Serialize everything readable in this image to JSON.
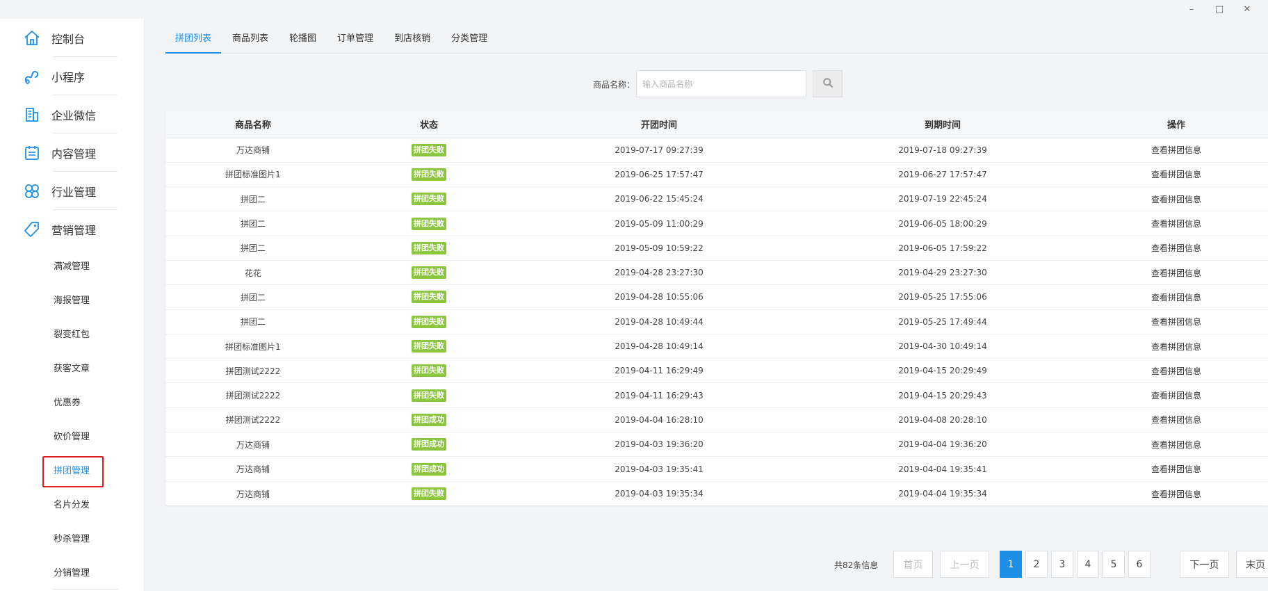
{
  "window": {
    "minimize": "–",
    "maximize": "□",
    "close": "✕"
  },
  "sidebar": {
    "items": [
      {
        "label": "控制台",
        "icon": "home-icon"
      },
      {
        "label": "小程序",
        "icon": "mini-program-icon"
      },
      {
        "label": "企业微信",
        "icon": "building-icon"
      },
      {
        "label": "内容管理",
        "icon": "calendar-list-icon"
      },
      {
        "label": "行业管理",
        "icon": "clover-icon"
      },
      {
        "label": "营销管理",
        "icon": "tag-icon"
      }
    ],
    "sub_items": [
      {
        "label": "满减管理"
      },
      {
        "label": "海报管理"
      },
      {
        "label": "裂变红包"
      },
      {
        "label": "获客文章"
      },
      {
        "label": "优惠券"
      },
      {
        "label": "砍价管理"
      },
      {
        "label": "拼团管理",
        "active": true
      },
      {
        "label": "名片分发"
      },
      {
        "label": "秒杀管理"
      },
      {
        "label": "分销管理"
      }
    ]
  },
  "tabs": [
    {
      "label": "拼团列表",
      "active": true
    },
    {
      "label": "商品列表"
    },
    {
      "label": "轮播图"
    },
    {
      "label": "订单管理"
    },
    {
      "label": "到店核销"
    },
    {
      "label": "分类管理"
    }
  ],
  "search": {
    "label": "商品名称：",
    "placeholder": "输入商品名称",
    "value": "",
    "button_icon": "search-icon"
  },
  "table": {
    "headers": [
      "商品名称",
      "状态",
      "开团时间",
      "到期时间",
      "操作"
    ],
    "status_colors": {
      "拼团失败": "#8cc63f",
      "拼团成功": "#8cc63f"
    },
    "rows": [
      {
        "name": "万达商铺",
        "status": "拼团失败",
        "start": "2019-07-17 09:27:39",
        "end": "2019-07-18 09:27:39",
        "op": "查看拼团信息"
      },
      {
        "name": "拼团标准图片1",
        "status": "拼团失败",
        "start": "2019-06-25 17:57:47",
        "end": "2019-06-27 17:57:47",
        "op": "查看拼团信息"
      },
      {
        "name": "拼团二",
        "status": "拼团失败",
        "start": "2019-06-22 15:45:24",
        "end": "2019-07-19 22:45:24",
        "op": "查看拼团信息"
      },
      {
        "name": "拼团二",
        "status": "拼团失败",
        "start": "2019-05-09 11:00:29",
        "end": "2019-06-05 18:00:29",
        "op": "查看拼团信息"
      },
      {
        "name": "拼团二",
        "status": "拼团失败",
        "start": "2019-05-09 10:59:22",
        "end": "2019-06-05 17:59:22",
        "op": "查看拼团信息"
      },
      {
        "name": "花花",
        "status": "拼团失败",
        "start": "2019-04-28 23:27:30",
        "end": "2019-04-29 23:27:30",
        "op": "查看拼团信息"
      },
      {
        "name": "拼团二",
        "status": "拼团失败",
        "start": "2019-04-28 10:55:06",
        "end": "2019-05-25 17:55:06",
        "op": "查看拼团信息"
      },
      {
        "name": "拼团二",
        "status": "拼团失败",
        "start": "2019-04-28 10:49:44",
        "end": "2019-05-25 17:49:44",
        "op": "查看拼团信息"
      },
      {
        "name": "拼团标准图片1",
        "status": "拼团失败",
        "start": "2019-04-28 10:49:14",
        "end": "2019-04-30 10:49:14",
        "op": "查看拼团信息"
      },
      {
        "name": "拼团测试2222",
        "status": "拼团失败",
        "start": "2019-04-11 16:29:49",
        "end": "2019-04-15 20:29:49",
        "op": "查看拼团信息"
      },
      {
        "name": "拼团测试2222",
        "status": "拼团失败",
        "start": "2019-04-11 16:29:43",
        "end": "2019-04-15 20:29:43",
        "op": "查看拼团信息"
      },
      {
        "name": "拼团测试2222",
        "status": "拼团成功",
        "start": "2019-04-04 16:28:10",
        "end": "2019-04-08 20:28:10",
        "op": "查看拼团信息"
      },
      {
        "name": "万达商铺",
        "status": "拼团成功",
        "start": "2019-04-03 19:36:20",
        "end": "2019-04-04 19:36:20",
        "op": "查看拼团信息"
      },
      {
        "name": "万达商铺",
        "status": "拼团成功",
        "start": "2019-04-03 19:35:41",
        "end": "2019-04-04 19:35:41",
        "op": "查看拼团信息"
      },
      {
        "name": "万达商铺",
        "status": "拼团失败",
        "start": "2019-04-03 19:35:34",
        "end": "2019-04-04 19:35:34",
        "op": "查看拼团信息"
      }
    ]
  },
  "pagination": {
    "total_text": "共82条信息",
    "first": "首页",
    "prev": "上一页",
    "pages": [
      "1",
      "2",
      "3",
      "4",
      "5",
      "6"
    ],
    "current": "1",
    "next": "下一页",
    "last": "末页"
  },
  "colors": {
    "accent": "#1f8fe6",
    "badge_green": "#8cc63f",
    "highlight_red": "#e02020"
  }
}
